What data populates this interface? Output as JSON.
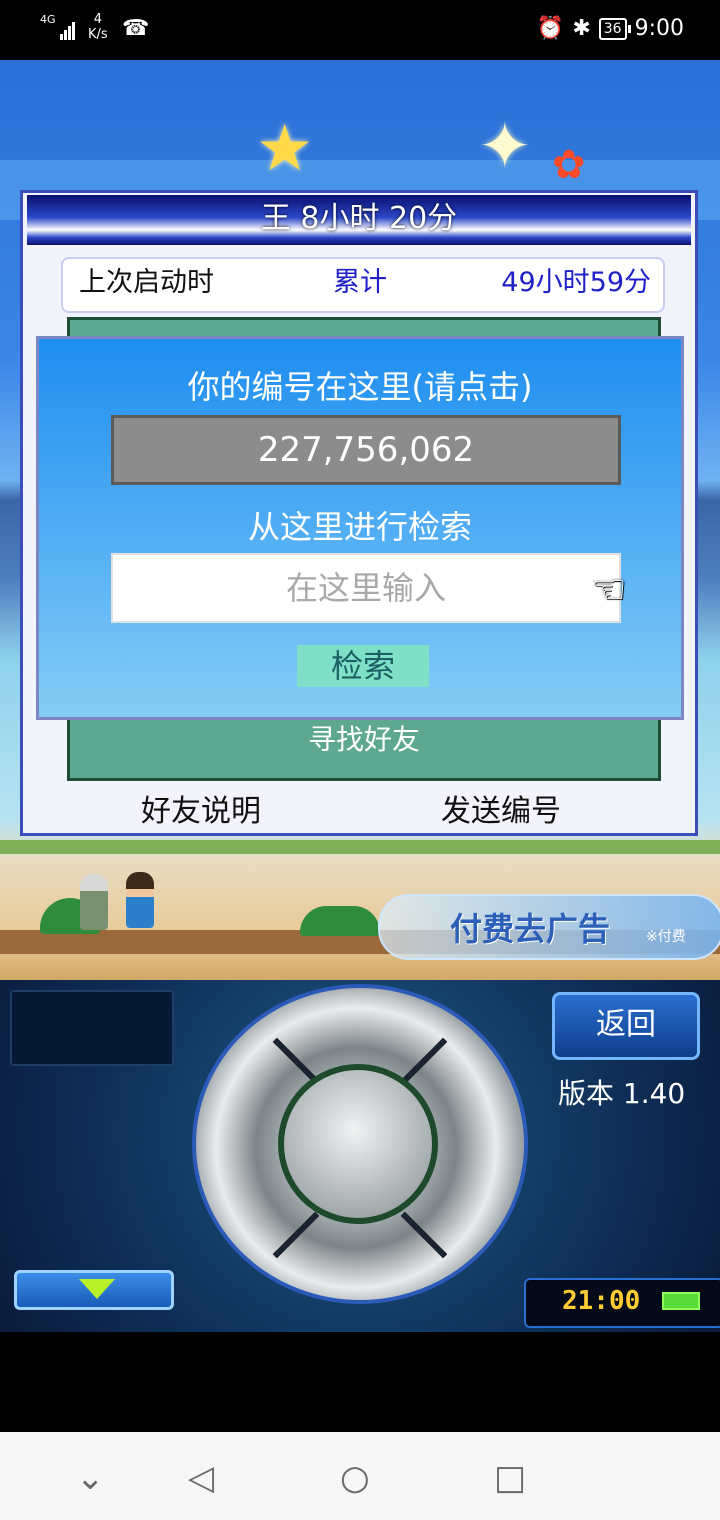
{
  "status_bar": {
    "network": "4G",
    "speed_value": "4",
    "speed_unit": "K/s",
    "battery": "36",
    "time": "9:00"
  },
  "dialog": {
    "title": "王  8小时 20分",
    "last_launch_label": "上次启动时",
    "total_label": "累计",
    "total_value": "49小时59分",
    "find_friend_label": "寻找好友",
    "friend_help_label": "好友说明",
    "send_id_label": "发送编号"
  },
  "search_overlay": {
    "id_prompt": "你的编号在这里(请点击)",
    "user_id": "227,756,062",
    "search_prompt": "从这里进行检索",
    "input_placeholder": "在这里输入",
    "search_button": "检索"
  },
  "ad_badge": {
    "label": "付费去广告",
    "note": "※付费"
  },
  "controller": {
    "back_button": "返回",
    "version": "版本 1.40",
    "clock": "21:00"
  },
  "colors": {
    "dialog_border": "#3a4db8",
    "overlay_blue": "#1e8ef0",
    "search_button": "#7ee0c6",
    "friend_area": "#5ea892"
  }
}
